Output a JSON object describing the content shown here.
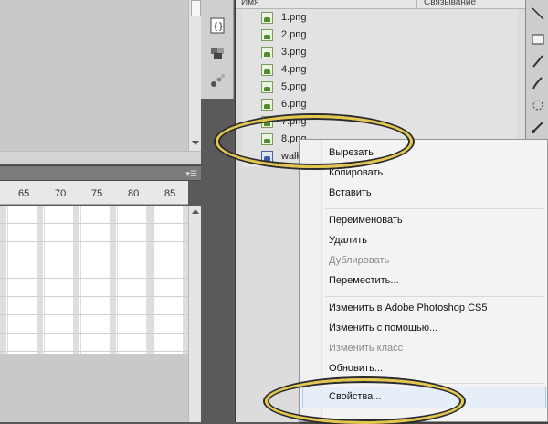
{
  "timeline": {
    "ruler_labels": [
      "65",
      "70",
      "75",
      "80",
      "85"
    ]
  },
  "library": {
    "header": {
      "name_col": "Имя",
      "linkage_col": "Связывание"
    },
    "items": [
      {
        "label": "1.png",
        "icon": "bitmap-icon"
      },
      {
        "label": "2.png",
        "icon": "bitmap-icon"
      },
      {
        "label": "3.png",
        "icon": "bitmap-icon"
      },
      {
        "label": "4.png",
        "icon": "bitmap-icon"
      },
      {
        "label": "5.png",
        "icon": "bitmap-icon"
      },
      {
        "label": "6.png",
        "icon": "bitmap-icon"
      },
      {
        "label": "7.png",
        "icon": "bitmap-icon"
      },
      {
        "label": "8.png",
        "icon": "bitmap-icon"
      },
      {
        "label": "walk",
        "icon": "movieclip-symbol-icon"
      }
    ]
  },
  "context_menu": {
    "items": [
      {
        "label": "Вырезать",
        "enabled": true
      },
      {
        "label": "Копировать",
        "enabled": true
      },
      {
        "label": "Вставить",
        "enabled": true
      },
      {
        "label": "Переименовать",
        "enabled": true
      },
      {
        "label": "Удалить",
        "enabled": true
      },
      {
        "label": "Дублировать",
        "enabled": false
      },
      {
        "label": "Переместить...",
        "enabled": true
      },
      {
        "label": "Изменить в Adobe Photoshop CS5",
        "enabled": true
      },
      {
        "label": "Изменить с помощью...",
        "enabled": true
      },
      {
        "label": "Изменить класс",
        "enabled": false
      },
      {
        "label": "Обновить...",
        "enabled": true
      },
      {
        "label": "Свойства...",
        "enabled": true,
        "highlighted": true
      }
    ]
  },
  "colors": {
    "annotation_ring": "#e3c64b",
    "menu_highlight": "#e6eef8",
    "bitmap_icon": "#4f8e2e"
  }
}
